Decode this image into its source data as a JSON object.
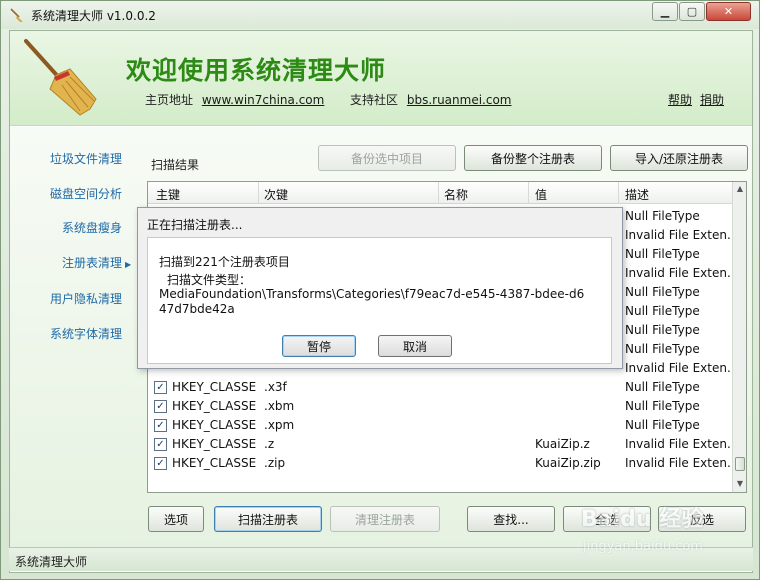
{
  "window": {
    "title": "系统清理大师 v1.0.0.2",
    "min_icon": "minimize-icon",
    "max_icon": "maximize-icon",
    "close_icon": "close-icon"
  },
  "header": {
    "banner_title": "欢迎使用系统清理大师",
    "homepage_label": "主页地址",
    "homepage_url": "www.win7china.com",
    "community_label": "支持社区",
    "community_url": "bbs.ruanmei.com",
    "help_link": "帮助",
    "donate_link": "捐助"
  },
  "sidebar": {
    "items": [
      {
        "label": "垃圾文件清理",
        "active": false
      },
      {
        "label": "磁盘空间分析",
        "active": false
      },
      {
        "label": "系统盘瘦身",
        "active": false
      },
      {
        "label": "注册表清理",
        "active": true
      },
      {
        "label": "用户隐私清理",
        "active": false
      },
      {
        "label": "系统字体清理",
        "active": false
      }
    ]
  },
  "toolbar": {
    "scan_result_label": "扫描结果",
    "backup_selected": "备份选中项目",
    "backup_all": "备份整个注册表",
    "import_restore": "导入/还原注册表"
  },
  "table": {
    "columns": [
      "主键",
      "次键",
      "名称",
      "值",
      "描述"
    ],
    "hidden_rows": [
      {
        "description": "Null FileType"
      },
      {
        "description": "Invalid File Exten..."
      },
      {
        "description": "Null FileType"
      },
      {
        "description": "Invalid File Exten..."
      },
      {
        "description": "Null FileType"
      },
      {
        "description": "Null FileType"
      },
      {
        "description": "Null FileType"
      },
      {
        "description": "Null FileType"
      },
      {
        "description": "Invalid File Exten..."
      }
    ],
    "rows": [
      {
        "checked": true,
        "main": "HKEY_CLASSE...",
        "sub": ".x3f",
        "name": "",
        "value": "",
        "description": "Null FileType"
      },
      {
        "checked": true,
        "main": "HKEY_CLASSE...",
        "sub": ".xbm",
        "name": "",
        "value": "",
        "description": "Null FileType"
      },
      {
        "checked": true,
        "main": "HKEY_CLASSE...",
        "sub": ".xpm",
        "name": "",
        "value": "",
        "description": "Null FileType"
      },
      {
        "checked": true,
        "main": "HKEY_CLASSE...",
        "sub": ".z",
        "name": "",
        "value": "KuaiZip.z",
        "description": "Invalid File Exten..."
      },
      {
        "checked": true,
        "main": "HKEY_CLASSE...",
        "sub": ".zip",
        "name": "",
        "value": "KuaiZip.zip",
        "description": "Invalid File Exten..."
      }
    ]
  },
  "dialog": {
    "title": "正在扫描注册表...",
    "found_text": "扫描到221个注册表项目",
    "type_label": "扫描文件类型：",
    "path": "MediaFoundation\\Transforms\\Categories\\f79eac7d-e545-4387-bdee-d647d7bde42a",
    "pause": "暂停",
    "cancel": "取消"
  },
  "bottom": {
    "options": "选项",
    "scan": "扫描注册表",
    "clean": "清理注册表",
    "find": "查找...",
    "select_all": "全选",
    "invert": "反选"
  },
  "status": {
    "text": "系统清理大师"
  },
  "watermark": {
    "logo": "Baidu 经验",
    "site": "jingyan.baidu.com"
  }
}
